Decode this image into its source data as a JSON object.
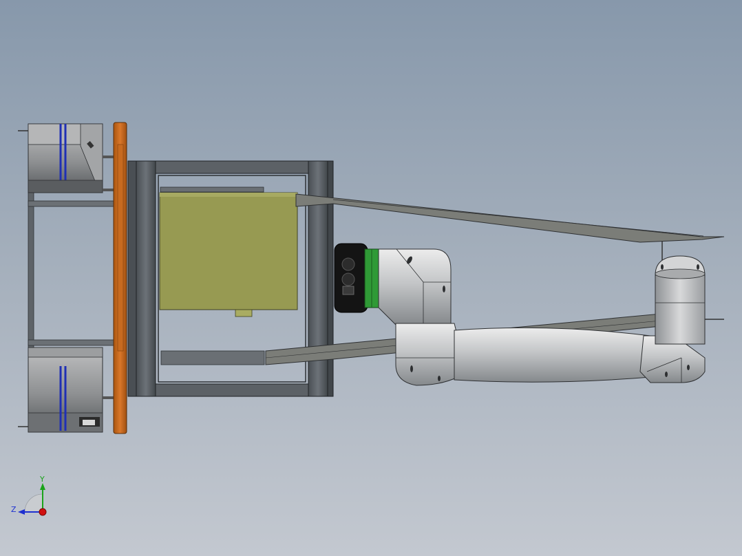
{
  "viewport": {
    "background_top": "#8798ab",
    "background_bottom": "#c3c8d0"
  },
  "model": {
    "description_icon": "cad-assembly-robot-arm-on-cart",
    "colors": {
      "frame": "#5d6267",
      "frame_dark": "#3f4448",
      "plate": "#c8691c",
      "box": "#979a52",
      "arm": "#c9cbcd",
      "arm_shadow": "#8f9295",
      "accent_green": "#2f9a36",
      "stripe_blue": "#1f2fb4",
      "black_joint": "#121212"
    }
  },
  "triad": {
    "y_label": "Y",
    "z_label": "Z",
    "y_color": "#1aa31a",
    "z_color": "#1d2fd0",
    "x_color": "#d01010"
  }
}
